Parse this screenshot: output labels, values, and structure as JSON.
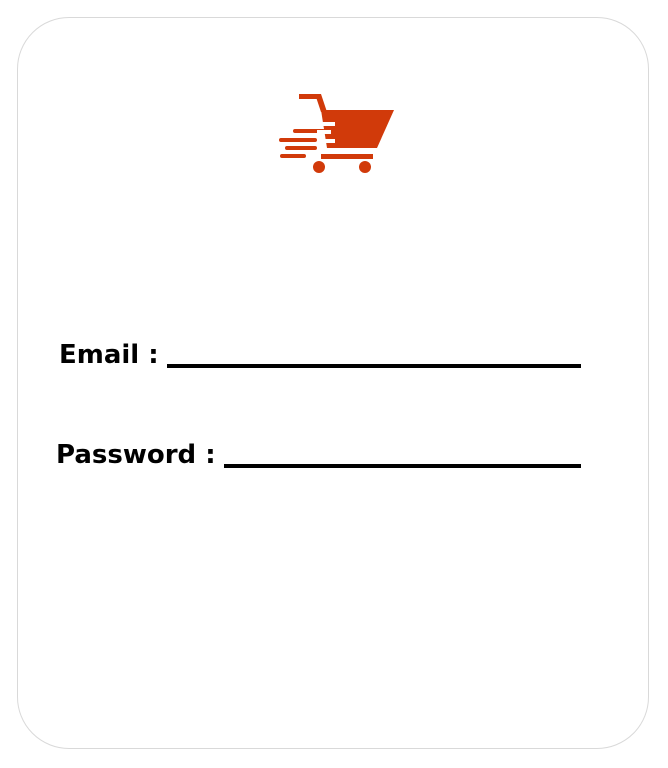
{
  "brand": {
    "logo_icon": "shopping-cart-icon",
    "accent_color": "#d13a0a"
  },
  "login_form": {
    "email": {
      "label": "Email :",
      "value": "",
      "placeholder": ""
    },
    "password": {
      "label": "Password :",
      "value": "",
      "placeholder": ""
    }
  }
}
